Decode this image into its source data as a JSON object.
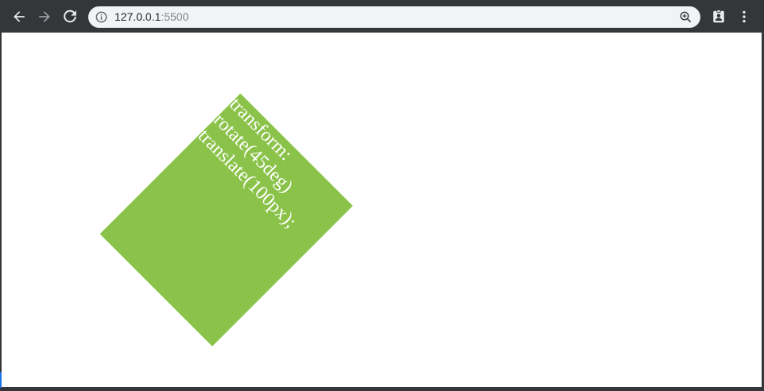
{
  "browser": {
    "url_host": "127.0.0.1",
    "url_port": ":5500",
    "icons": {
      "back": "arrow-left-icon",
      "forward": "arrow-right-icon",
      "reload": "reload-icon",
      "site_info": "info-icon",
      "zoom": "zoom-icon",
      "profile": "profile-icon",
      "menu": "kebab-menu-icon"
    }
  },
  "page": {
    "box_text": "transform: rotate(45deg) translate(100px);",
    "box_color": "#8bc34a"
  }
}
